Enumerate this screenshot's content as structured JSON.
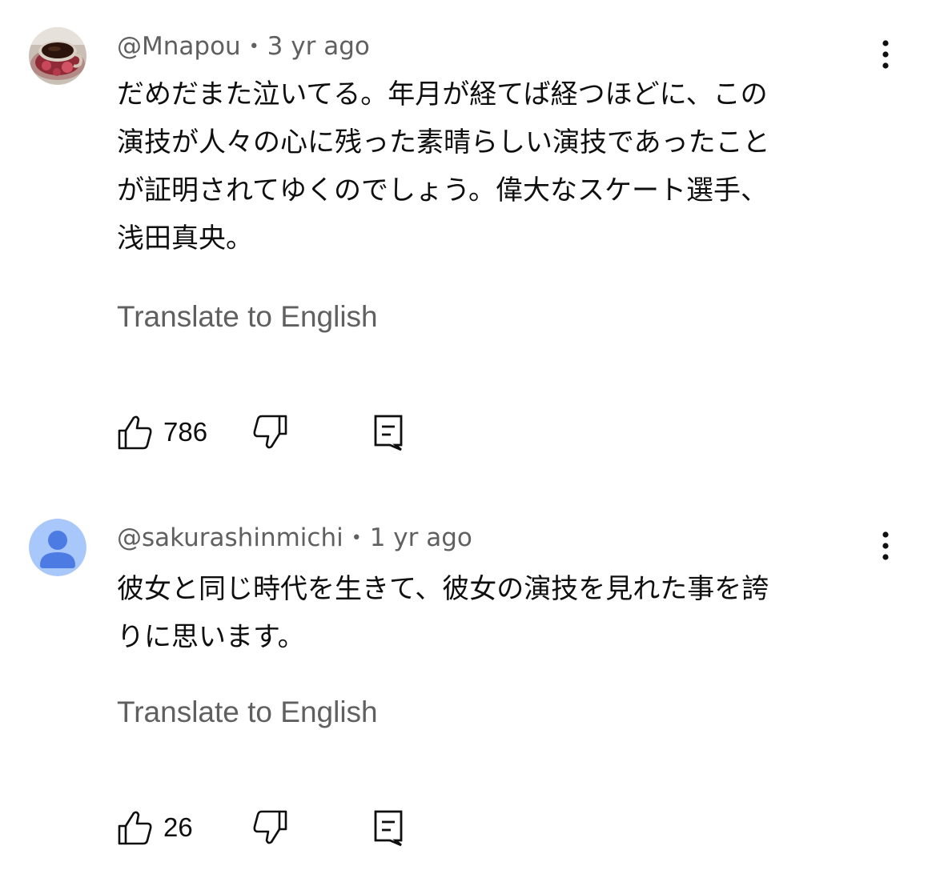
{
  "comments": [
    {
      "handle": "@Mnapou",
      "separator": "•",
      "time": "3 yr ago",
      "text": "だめだまた泣いてる。年月が経てば経つほどに、この\n演技が人々の心に残った素晴らしい演技であったこと\nが証明されてゆくのでしょう。偉大なスケート選手、\n浅田真央。",
      "translate_label": "Translate to English",
      "likes": "786",
      "avatar_icon": "coffee-cup-photo-icon"
    },
    {
      "handle": "@sakurashinmichi",
      "separator": "•",
      "time": "1 yr ago",
      "text": "彼女と同じ時代を生きて、彼女の演技を見れた事を誇\nりに思います。",
      "translate_label": "Translate to English",
      "likes": "26",
      "avatar_icon": "default-user-icon"
    }
  ],
  "colors": {
    "text_primary": "#0f0f0f",
    "text_secondary": "#606060",
    "default_avatar_bg": "#a8c7fa",
    "default_avatar_fg": "#4c7be3"
  }
}
